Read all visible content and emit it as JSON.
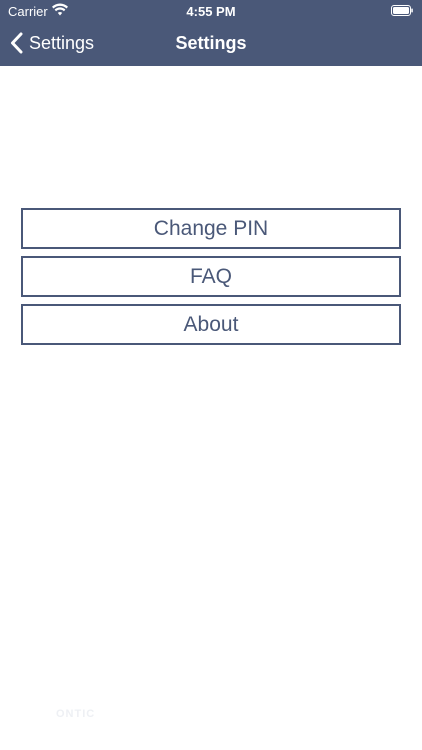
{
  "status_bar": {
    "carrier": "Carrier",
    "time": "4:55 PM",
    "icons": [
      "wifi-icon",
      "battery-icon"
    ]
  },
  "nav": {
    "back_label": "Settings",
    "title": "Settings",
    "back_icon": "chevron-left-icon"
  },
  "menu": {
    "items": [
      {
        "label": "Change PIN"
      },
      {
        "label": "FAQ"
      },
      {
        "label": "About"
      }
    ]
  },
  "footer": {
    "watermark": "ONTIC"
  },
  "colors": {
    "accent": "#4a5878",
    "background": "#ffffff",
    "bar_text": "#ffffff"
  }
}
